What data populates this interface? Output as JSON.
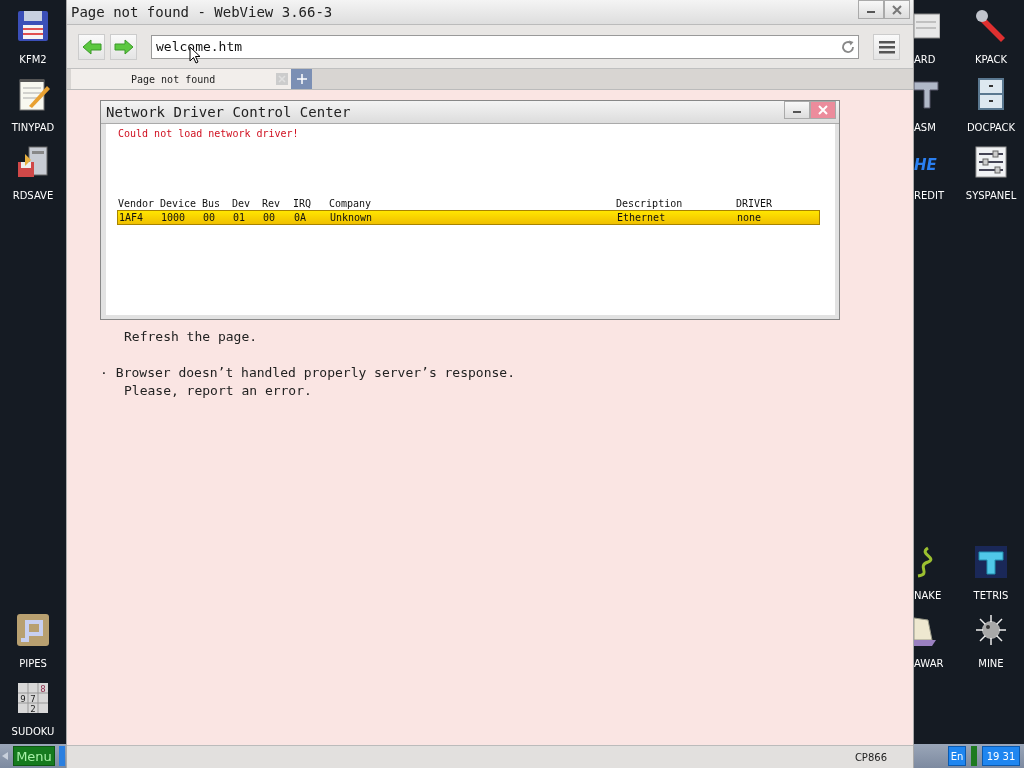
{
  "desktop": {
    "left_top_icons": [
      {
        "label": "KFM2"
      },
      {
        "label": "TINYPAD"
      },
      {
        "label": "RDSAVE"
      }
    ],
    "left_bottom_icons": [
      {
        "label": "PIPES"
      },
      {
        "label": "SUDOKU",
        "digits": [
          "8",
          "9",
          "7",
          "2"
        ]
      }
    ],
    "right_cut_icons": [
      {
        "label": "ARD"
      },
      {
        "label": "ASM"
      },
      {
        "label": "REDIT",
        "logo": "HE"
      },
      {
        "label": "NAKE"
      },
      {
        "label": "AWAR"
      }
    ],
    "right_icons": [
      {
        "label": "KPACK"
      },
      {
        "label": "DOCPACK"
      },
      {
        "label": "SYSPANEL"
      },
      {
        "label": "TETRIS"
      },
      {
        "label": "MINE"
      }
    ]
  },
  "browser": {
    "title": "Page not found - WebView 3.66-3",
    "address": "welcome.htm",
    "tabs": [
      {
        "label": "Page not found",
        "selected": true
      }
    ],
    "content": [
      {
        "kind": "continuation",
        "text": "Refresh the page."
      },
      {
        "kind": "bullet",
        "bullet": "·",
        "text": "Browser doesn’t handled properly server’s response."
      },
      {
        "kind": "continuation",
        "text": "Please, report an error."
      }
    ],
    "status_bar": "CP866"
  },
  "dialog": {
    "title": "Network Driver Control Center",
    "error": "Could not load network driver!",
    "table": {
      "columns": [
        "Vendor",
        "Device",
        "Bus",
        "Dev",
        "Rev",
        "IRQ",
        "Company",
        "Description",
        "DRIVER"
      ],
      "rows": [
        {
          "cells": [
            "1AF4",
            "1000",
            "00",
            "01",
            "00",
            "0A",
            "Unknown",
            "Ethernet",
            "none"
          ],
          "selected": true
        }
      ]
    }
  },
  "taskbar": {
    "menu": "Menu",
    "language": "En",
    "clock": "19 31"
  }
}
